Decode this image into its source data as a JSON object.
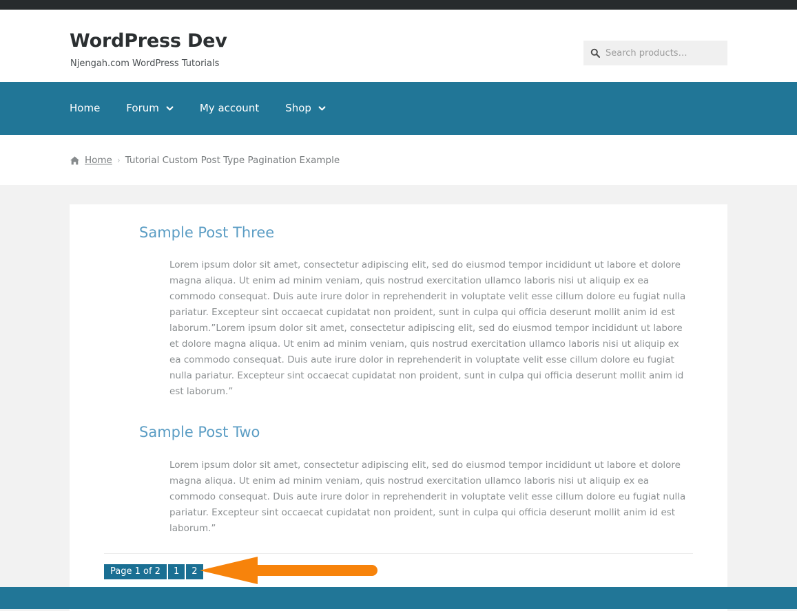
{
  "site": {
    "title": "WordPress Dev",
    "description": "Njengah.com WordPress Tutorials"
  },
  "search": {
    "icon": "search-icon",
    "placeholder": "Search products…",
    "value": ""
  },
  "nav": {
    "items": [
      {
        "label": "Home",
        "has_dropdown": false
      },
      {
        "label": "Forum",
        "has_dropdown": true
      },
      {
        "label": "My account",
        "has_dropdown": false
      },
      {
        "label": "Shop",
        "has_dropdown": true
      }
    ]
  },
  "breadcrumb": {
    "home_icon": "home-icon",
    "home_label": "Home",
    "separator": "›",
    "current": "Tutorial Custom Post Type Pagination Example"
  },
  "posts": [
    {
      "title": "Sample Post Three",
      "body": "Lorem ipsum dolor sit amet, consectetur adipiscing elit, sed do eiusmod tempor incididunt ut labore et dolore magna aliqua. Ut enim ad minim veniam, quis nostrud exercitation ullamco laboris nisi ut aliquip ex ea commodo consequat. Duis aute irure dolor in reprehenderit in voluptate velit esse cillum dolore eu fugiat nulla pariatur. Excepteur sint occaecat cupidatat non proident, sunt in culpa qui officia deserunt mollit anim id est laborum.”Lorem ipsum dolor sit amet, consectetur adipiscing elit, sed do eiusmod tempor incididunt ut labore et dolore magna aliqua. Ut enim ad minim veniam, quis nostrud exercitation ullamco laboris nisi ut aliquip ex ea commodo consequat. Duis aute irure dolor in reprehenderit in voluptate velit esse cillum dolore eu fugiat nulla pariatur. Excepteur sint occaecat cupidatat non proident, sunt in culpa qui officia deserunt mollit anim id est laborum.”"
    },
    {
      "title": "Sample Post Two",
      "body": "Lorem ipsum dolor sit amet, consectetur adipiscing elit, sed do eiusmod tempor incididunt ut labore et dolore magna aliqua. Ut enim ad minim veniam, quis nostrud exercitation ullamco laboris nisi ut aliquip ex ea commodo consequat. Duis aute irure dolor in reprehenderit in voluptate velit esse cillum dolore eu fugiat nulla pariatur. Excepteur sint occaecat cupidatat non proident, sunt in culpa qui officia deserunt mollit anim id est laborum.”"
    }
  ],
  "pagination": {
    "info_label": "Page 1 of 2",
    "pages": [
      {
        "label": "1",
        "current": true
      },
      {
        "label": "2",
        "current": false
      }
    ]
  },
  "annotation": {
    "name": "orange-left-arrow",
    "color": "#F7830B",
    "direction": "left"
  },
  "colors": {
    "nav_background": "#217697",
    "topbar_background": "#272b2d",
    "page_background": "#f2f2f2",
    "card_background": "#ffffff",
    "post_title": "#5b9dc4",
    "body_text": "#8b8f91",
    "pagination_background": "#1a6f93",
    "annotation_orange": "#F7830B"
  }
}
